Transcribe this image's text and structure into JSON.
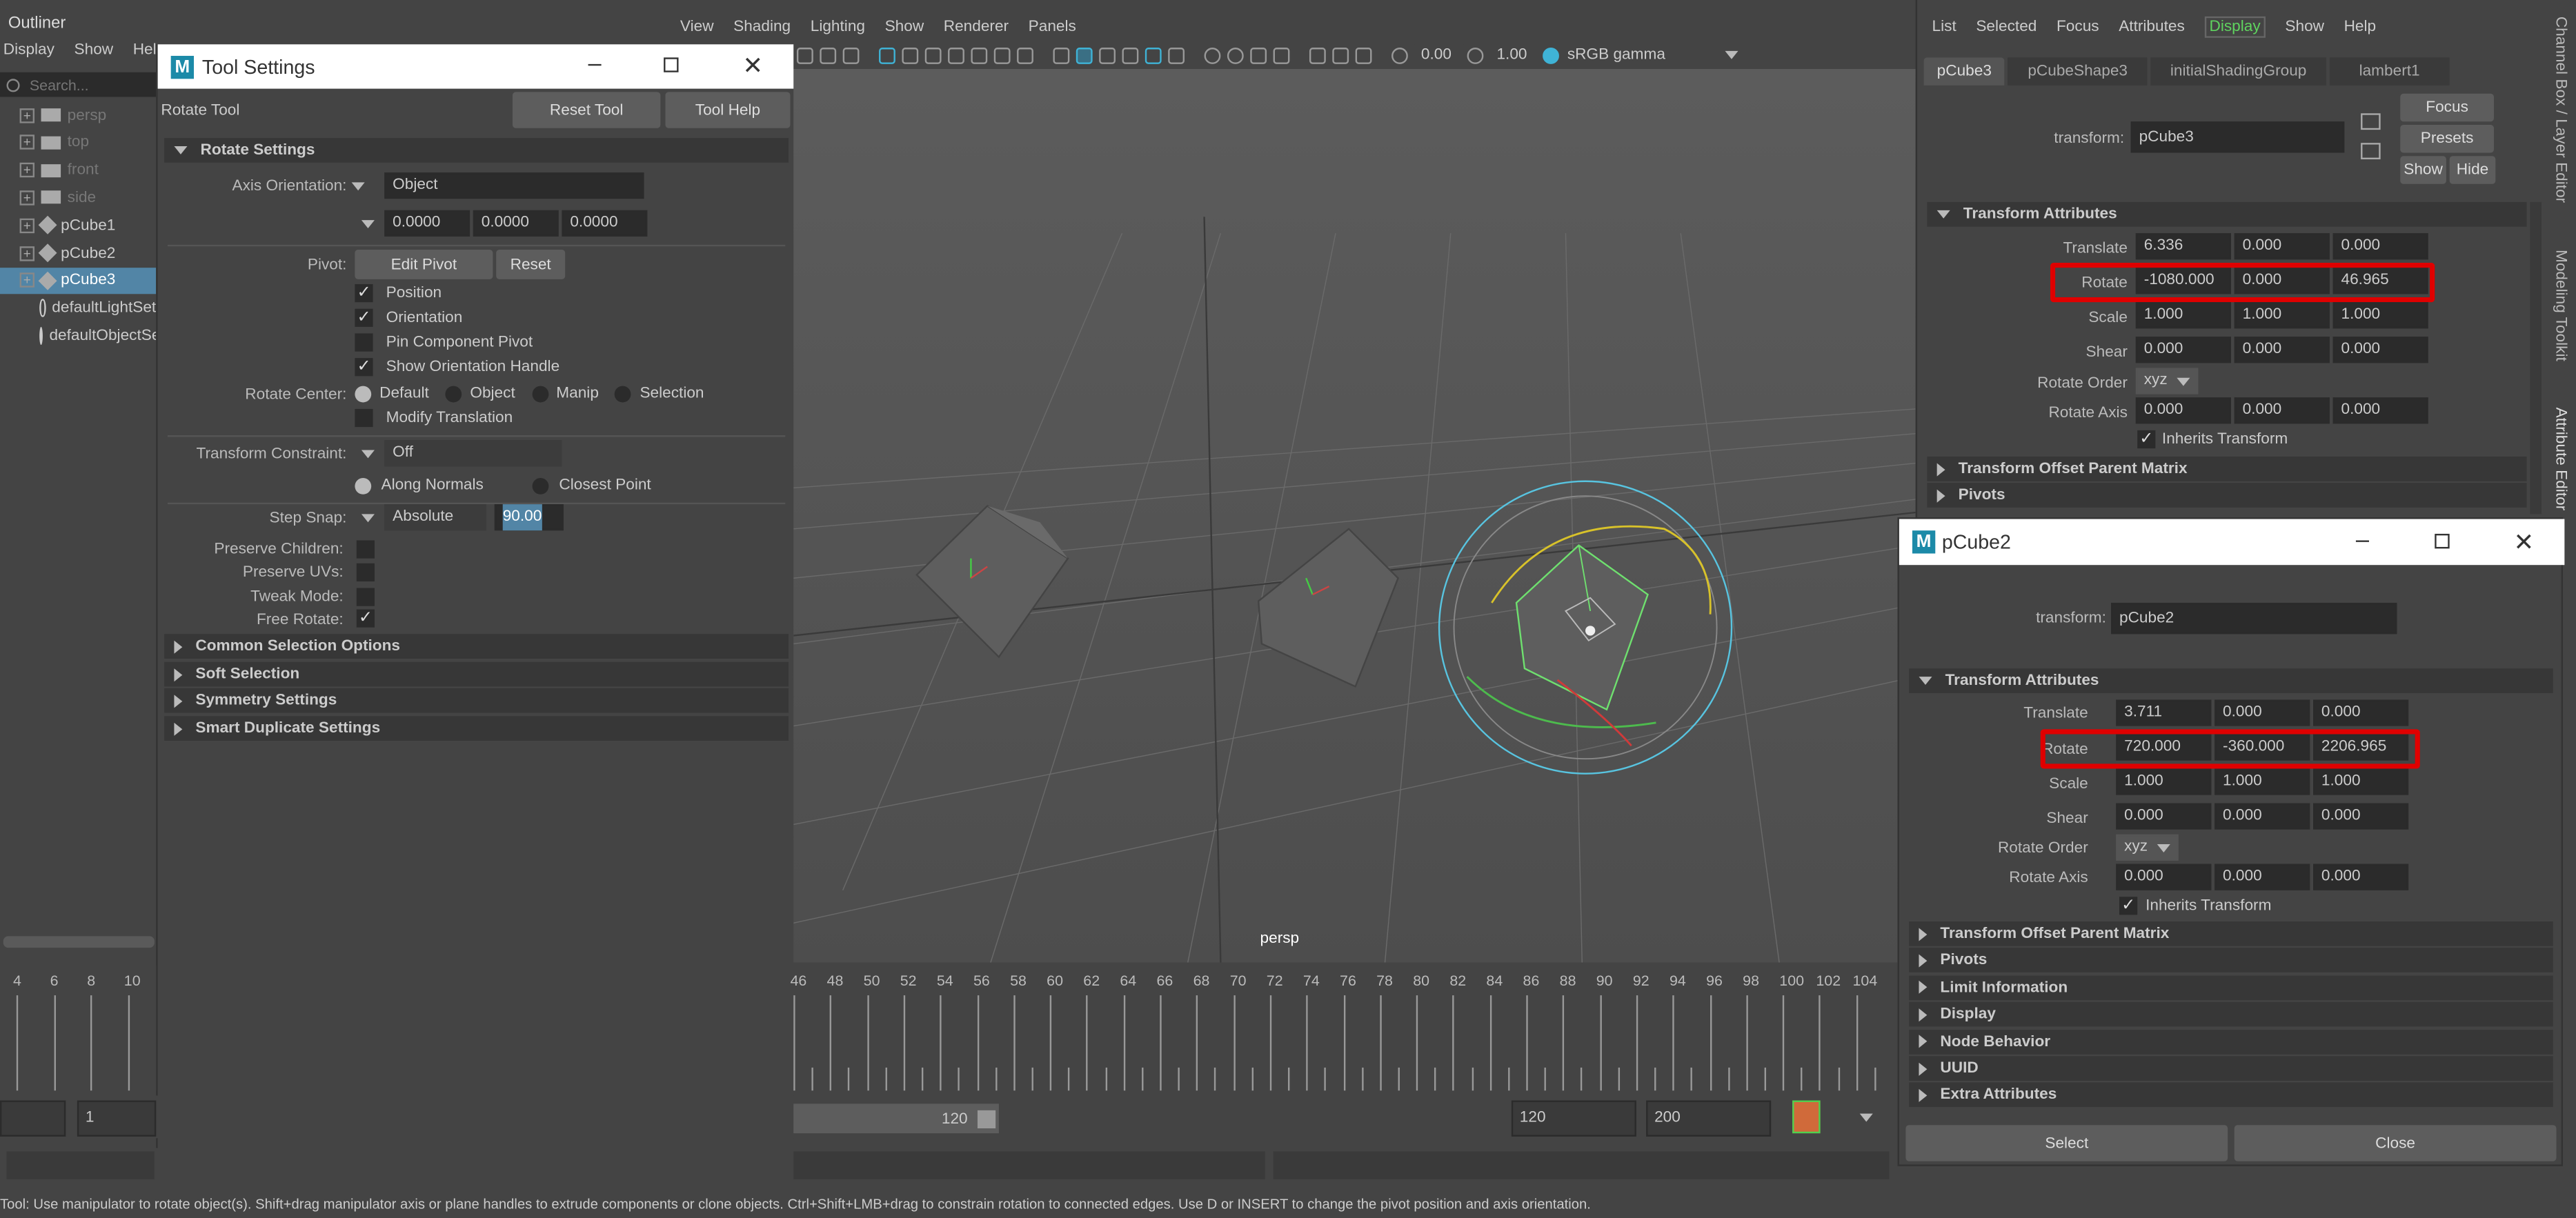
{
  "outliner": {
    "title": "Outliner",
    "menu": [
      "Display",
      "Show",
      "Help"
    ],
    "search_placeholder": "Search...",
    "items": [
      {
        "name": "persp",
        "dim": true
      },
      {
        "name": "top",
        "dim": true
      },
      {
        "name": "front",
        "dim": true
      },
      {
        "name": "side",
        "dim": true
      },
      {
        "name": "pCube1",
        "dim": false
      },
      {
        "name": "pCube2",
        "dim": false
      },
      {
        "name": "pCube3",
        "dim": false,
        "selected": true
      },
      {
        "name": "defaultLightSet",
        "dim": false
      },
      {
        "name": "defaultObjectSet",
        "dim": false
      }
    ]
  },
  "tool_settings": {
    "title": "Tool Settings",
    "tool_name": "Rotate Tool",
    "reset_tool": "Reset Tool",
    "tool_help": "Tool Help",
    "section_rotate": "Rotate Settings",
    "axis_orientation_label": "Axis Orientation:",
    "axis_orientation_value": "Object",
    "axis_values": [
      "0.0000",
      "0.0000",
      "0.0000"
    ],
    "pivot_label": "Pivot:",
    "edit_pivot": "Edit Pivot",
    "reset": "Reset",
    "position": "Position",
    "orientation": "Orientation",
    "pin_component_pivot": "Pin Component Pivot",
    "show_orientation_handle": "Show Orientation Handle",
    "rotate_center_label": "Rotate Center:",
    "rc_default": "Default",
    "rc_object": "Object",
    "rc_manip": "Manip",
    "rc_selection": "Selection",
    "modify_translation": "Modify Translation",
    "transform_constraint_label": "Transform Constraint:",
    "transform_constraint_value": "Off",
    "along_normals": "Along Normals",
    "closest_point": "Closest Point",
    "step_snap_label": "Step Snap:",
    "step_snap_mode": "Absolute",
    "step_snap_value": "90.00",
    "preserve_children": "Preserve Children:",
    "preserve_uvs": "Preserve UVs:",
    "tweak_mode": "Tweak Mode:",
    "free_rotate": "Free Rotate:",
    "sections": [
      "Common Selection Options",
      "Soft Selection",
      "Symmetry Settings",
      "Smart Duplicate Settings"
    ]
  },
  "viewport": {
    "menu": [
      "View",
      "Shading",
      "Lighting",
      "Show",
      "Renderer",
      "Panels"
    ],
    "exposure": "0.00",
    "gamma": "1.00",
    "color_space": "sRGB gamma",
    "camera_label": "persp"
  },
  "timeline": {
    "left_ticks": [
      "4",
      "6",
      "8",
      "10"
    ],
    "ticks": [
      "46",
      "48",
      "50",
      "52",
      "54",
      "56",
      "58",
      "60",
      "62",
      "64",
      "66",
      "68",
      "70",
      "72",
      "74",
      "76",
      "78",
      "80",
      "82",
      "84",
      "86",
      "88",
      "90",
      "92",
      "94",
      "96",
      "98",
      "100",
      "102",
      "104"
    ],
    "range_start": "1",
    "range_end_inner": "120",
    "range_end": "120",
    "range_max": "200"
  },
  "attribute_editor": {
    "menu": [
      "List",
      "Selected",
      "Focus",
      "Attributes",
      "Display",
      "Show",
      "Help"
    ],
    "active_menu": "Display",
    "tabs": [
      "pCube3",
      "pCubeShape3",
      "initialShadingGroup",
      "lambert1"
    ],
    "transform_label": "transform:",
    "transform_value": "pCube3",
    "focus": "Focus",
    "presets": "Presets",
    "show": "Show",
    "hide": "Hide",
    "section": "Transform Attributes",
    "translate_label": "Translate",
    "translate": [
      "6.336",
      "0.000",
      "0.000"
    ],
    "rotate_label": "Rotate",
    "rotate": [
      "-1080.000",
      "0.000",
      "46.965"
    ],
    "scale_label": "Scale",
    "scale": [
      "1.000",
      "1.000",
      "1.000"
    ],
    "shear_label": "Shear",
    "shear": [
      "0.000",
      "0.000",
      "0.000"
    ],
    "rotate_order_label": "Rotate Order",
    "rotate_order": "xyz",
    "rotate_axis_label": "Rotate Axis",
    "rotate_axis": [
      "0.000",
      "0.000",
      "0.000"
    ],
    "inherits_transform": "Inherits Transform",
    "collapsed": [
      "Transform Offset Parent Matrix",
      "Pivots"
    ],
    "side_tabs": [
      "Channel Box / Layer Editor",
      "Modeling Toolkit",
      "Attribute Editor"
    ]
  },
  "pcube2_window": {
    "title": "pCube2",
    "transform_label": "transform:",
    "transform_value": "pCube2",
    "section": "Transform Attributes",
    "translate_label": "Translate",
    "translate": [
      "3.711",
      "0.000",
      "0.000"
    ],
    "rotate_label": "Rotate",
    "rotate": [
      "720.000",
      "-360.000",
      "2206.965"
    ],
    "scale_label": "Scale",
    "scale": [
      "1.000",
      "1.000",
      "1.000"
    ],
    "shear_label": "Shear",
    "shear": [
      "0.000",
      "0.000",
      "0.000"
    ],
    "rotate_order_label": "Rotate Order",
    "rotate_order": "xyz",
    "rotate_axis_label": "Rotate Axis",
    "rotate_axis": [
      "0.000",
      "0.000",
      "0.000"
    ],
    "inherits_transform": "Inherits Transform",
    "collapsed": [
      "Transform Offset Parent Matrix",
      "Pivots",
      "Limit Information",
      "Display",
      "Node Behavior",
      "UUID",
      "Extra Attributes"
    ],
    "select": "Select",
    "close": "Close"
  },
  "help_line": "Tool: Use manipulator to rotate object(s). Shift+drag manipulator axis or plane handles to extrude components or clone objects. Ctrl+Shift+LMB+drag to constrain rotation to connected edges. Use D or INSERT to change the pivot position and axis orientation.",
  "colors": {
    "highlight": "#e00000",
    "selection": "#5285a6",
    "active_menu": "#5fd35f"
  }
}
